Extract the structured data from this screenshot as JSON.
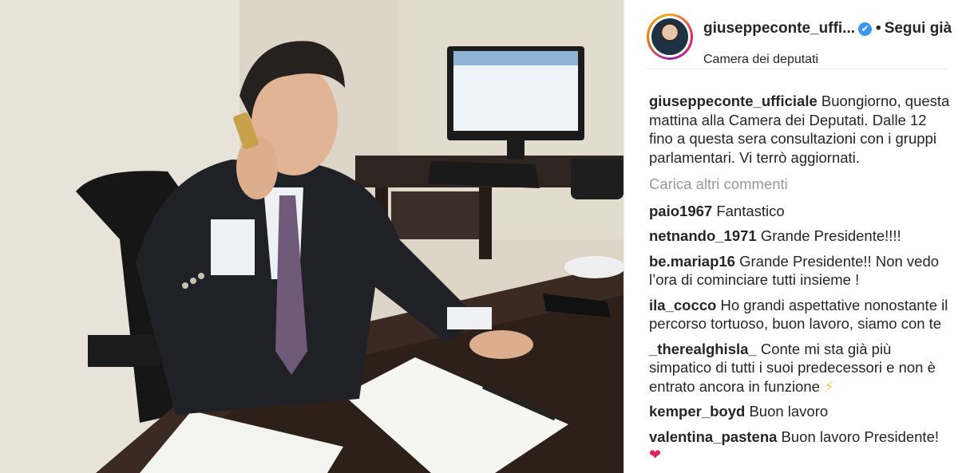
{
  "post": {
    "author": "giuseppeconte_uffi...",
    "verified_badge": "✔",
    "separator": "•",
    "follow_label": "Segui già",
    "location": "Camera dei deputati"
  },
  "caption": {
    "user": "giuseppeconte_ufficiale",
    "text": "Buongiorno, questa mattina alla Camera dei Deputati. Dalle 12 fino a questa sera consultazioni con i gruppi parlamentari. Vi terrò aggiornati."
  },
  "load_more_label": "Carica altri commenti",
  "comments": [
    {
      "user": "paio1967",
      "text": "Fantastico"
    },
    {
      "user": "netnando_1971",
      "text": "Grande Presidente!!!!"
    },
    {
      "user": "be.mariap16",
      "text": "Grande Presidente!! Non vedo l’ora di cominciare tutti insieme !"
    },
    {
      "user": "ila_cocco",
      "text": "Ho grandi aspettative nonostante il percorso tortuoso, buon lavoro, siamo con te"
    },
    {
      "user": "_therealghisla_",
      "text": "Conte mi sta già più simpatico di tutti i suoi predecessori e non è entrato ancora in funzione",
      "emoji": "⚡"
    },
    {
      "user": "kemper_boyd",
      "text": "Buon lavoro"
    },
    {
      "user": "valentina_pastena",
      "text": "Buon lavoro Presidente!",
      "emoji": "❤"
    }
  ],
  "icons": {
    "verified": "verified-badge-icon",
    "avatar": "profile-avatar",
    "bolt": "lightning-emoji",
    "heart": "heart-emoji"
  },
  "colors": {
    "verified_blue": "#3897f0",
    "muted_text": "#999999",
    "text": "#262626"
  }
}
